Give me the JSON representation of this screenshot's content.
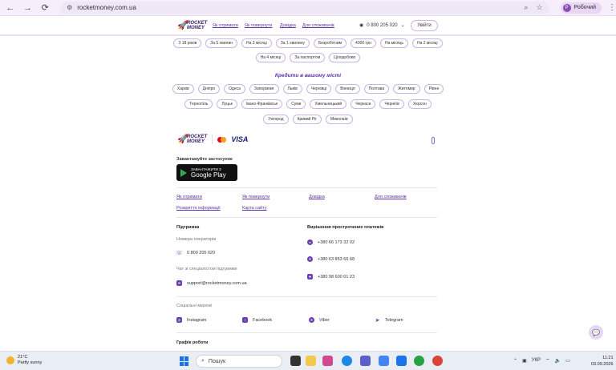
{
  "browser": {
    "url": "rocketmoney.com.ua",
    "profile_label": "Робочий",
    "profile_initial": "Р"
  },
  "header": {
    "logo_line1": "ROCKET",
    "logo_line2": "MONEY",
    "nav": [
      "Як отримати",
      "Як повернути",
      "Довідка",
      "Для споживачів"
    ],
    "phone": "0 800 205 020",
    "login_label": "Увійти"
  },
  "chips_top": {
    "row1": [
      "З 18 років",
      "За 5 хвилин",
      "На 3 місяці",
      "За 1 хвилину",
      "Безробітним",
      "4000 грн",
      "На місяць",
      "На 2 місяці"
    ],
    "row2": [
      "На 4 місяці",
      "За паспортом",
      "Цілодобово"
    ]
  },
  "cities": {
    "title": "Кредити в вашому місті",
    "row1": [
      "Харків",
      "Дніпро",
      "Одеса",
      "Запоріжжя",
      "Львів",
      "Чернівці",
      "Вінниця",
      "Полтава",
      "Житомир",
      "Рівне"
    ],
    "row2": [
      "Тернопіль",
      "Луцьк",
      "Івано-Франківськ",
      "Суми",
      "Хмельницький",
      "Черкаси",
      "Чернігів",
      "Херсон"
    ],
    "row3": [
      "Ужгород",
      "Кривий Ріг",
      "Миколаїв"
    ]
  },
  "footer": {
    "visa_label": "VISA",
    "app_download_label": "Завантажуйте застосунок",
    "google_play_small": "ЗАВАНТАЖИТИ З",
    "google_play_big": "Google Play",
    "links_row1": [
      "Як отримати",
      "Як повернути",
      "Довідка",
      "Для споживачів"
    ],
    "links_row2": [
      "Розкриття інформації",
      "Карта сайту"
    ],
    "support_title": "Підтримка",
    "operator_label": "Номера операторів",
    "operator_phone": "0 800 205 020",
    "chat_label": "Чат зі спеціалістом підтримки",
    "support_email": "support@rocketmoney.com.ua",
    "overdue_title": "Вирішення прострочених платежів",
    "overdue_phones": [
      "+380 66 173 32 02",
      "+380 63 853 66 68",
      "+380 98 600 01 23"
    ],
    "social_title": "Соціальні мережі",
    "social": [
      "Instagram",
      "Facebook",
      "Viber",
      "Telegram"
    ],
    "schedule_title": "Графік роботи"
  },
  "taskbar": {
    "temp": "21°C",
    "weather": "Partly sunny",
    "search_placeholder": "Пошук",
    "lang": "УКР",
    "time": "11:21",
    "date": "03.09.2026"
  },
  "colors": {
    "accent": "#5b35a6",
    "chip_border": "#c9b5e6",
    "chrome_bg": "#f6eefb"
  }
}
